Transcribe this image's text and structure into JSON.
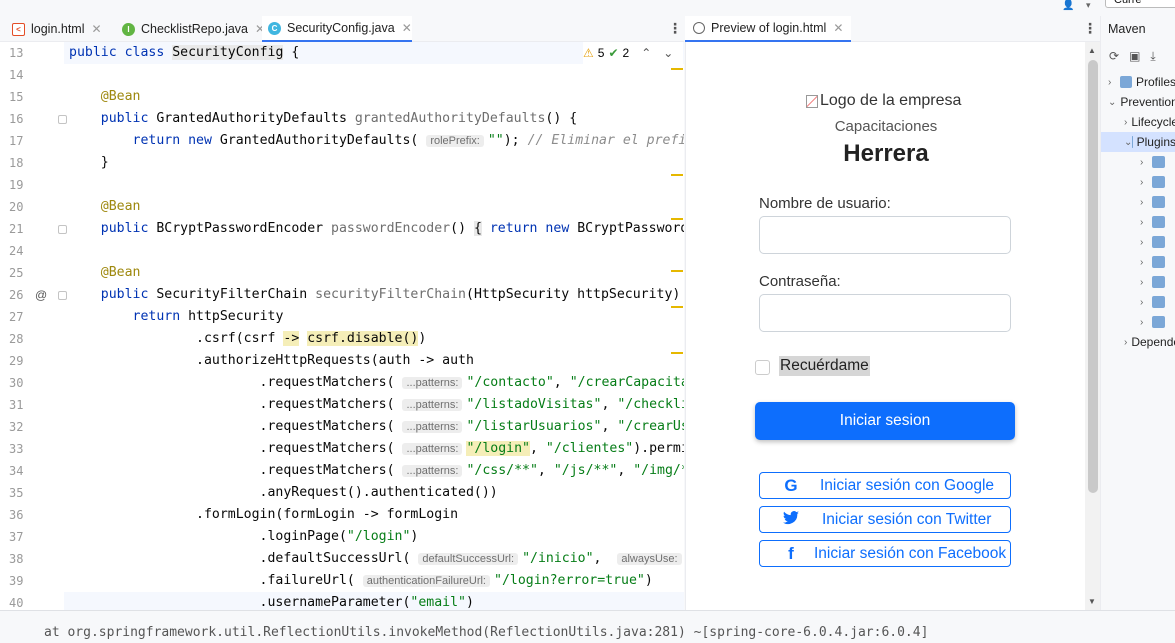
{
  "top": {
    "current_label": "Curre"
  },
  "editor_tabs": [
    {
      "label": "login.html",
      "icon": "html-file-icon",
      "color": "#e44d26"
    },
    {
      "label": "ChecklistRepo.java",
      "icon": "interface-icon",
      "color": "#62b543"
    },
    {
      "label": "SecurityConfig.java",
      "icon": "class-icon",
      "color": "#40b6e0"
    }
  ],
  "inspections": {
    "warnings": "5",
    "weak_warnings": "2"
  },
  "code_lines": [
    {
      "n": "13",
      "html": "<span class=\"kw\">public class</span> <span class=\"hlb\">SecurityConfig</span> {"
    },
    {
      "n": "14",
      "html": ""
    },
    {
      "n": "15",
      "html": "    <span class=\"ann\">@Bean</span>"
    },
    {
      "n": "16",
      "html": "    <span class=\"kw\">public</span> GrantedAuthorityDefaults <span class=\"unused\">grantedAuthorityDefaults</span>() {"
    },
    {
      "n": "17",
      "html": "        <span class=\"kw\">return new</span> GrantedAuthorityDefaults( <span class=\"hint\">rolePrefix:</span><span class=\"str\">\"\"</span>); <span class=\"cm\">// Eliminar el prefijo ROLE_</span>"
    },
    {
      "n": "18",
      "html": "    }"
    },
    {
      "n": "19",
      "html": ""
    },
    {
      "n": "20",
      "html": "    <span class=\"ann\">@Bean</span>"
    },
    {
      "n": "21",
      "html": "    <span class=\"kw\">public</span> BCryptPasswordEncoder <span class=\"unused\">passwordEncoder</span>() <span class=\"hlb\">{</span> <span class=\"kw\">return new</span> BCryptPasswordEncoder(); }"
    },
    {
      "n": "24",
      "html": ""
    },
    {
      "n": "25",
      "html": "    <span class=\"ann\">@Bean</span>"
    },
    {
      "n": "26",
      "html": "    <span class=\"kw\">public</span> SecurityFilterChain <span class=\"unused\">securityFilterChain</span>(HttpSecurity httpSecurity) <span class=\"kw\">throws</span>"
    },
    {
      "n": "27",
      "html": "        <span class=\"kw\">return</span> httpSecurity"
    },
    {
      "n": "28",
      "html": "                .csrf(csrf <span class=\"hl\">-&gt;</span> <span class=\"hl\">csrf.disable()</span>)"
    },
    {
      "n": "29",
      "html": "                .authorizeHttpRequests(auth -&gt; auth"
    },
    {
      "n": "30",
      "html": "                        .requestMatchers( <span class=\"hint\">...patterns:</span><span class=\"str\">\"/contacto\"</span>, <span class=\"str\">\"/crearCapacitacion\"</span>"
    },
    {
      "n": "31",
      "html": "                        .requestMatchers( <span class=\"hint\">...patterns:</span><span class=\"str\">\"/listadoVisitas\"</span>, <span class=\"str\">\"/checklist\"</span>"
    },
    {
      "n": "32",
      "html": "                        .requestMatchers( <span class=\"hint\">...patterns:</span><span class=\"str\">\"/listarUsuarios\"</span>, <span class=\"str\">\"/crearUsuario\"</span>"
    },
    {
      "n": "33",
      "html": "                        .requestMatchers( <span class=\"hint\">...patterns:</span><span class=\"str hl\">\"/login\"</span>, <span class=\"str\">\"/clientes\"</span>).permitAll()"
    },
    {
      "n": "34",
      "html": "                        .requestMatchers( <span class=\"hint\">...patterns:</span><span class=\"str\">\"/css/**\"</span>, <span class=\"str\">\"/js/**\"</span>, <span class=\"str\">\"/img/**\"</span>"
    },
    {
      "n": "35",
      "html": "                        .anyRequest().authenticated())"
    },
    {
      "n": "36",
      "html": "                .formLogin(formLogin -&gt; formLogin"
    },
    {
      "n": "37",
      "html": "                        .loginPage(<span class=\"str\">\"/login\"</span>)"
    },
    {
      "n": "38",
      "html": "                        .defaultSuccessUrl( <span class=\"hint\">defaultSuccessUrl:</span><span class=\"str\">\"/inicio\"</span>,  <span class=\"hint\">alwaysUse:</span><span class=\"kw\">true</span>)"
    },
    {
      "n": "39",
      "html": "                        .failureUrl( <span class=\"hint\">authenticationFailureUrl:</span><span class=\"str\">\"/login?error=true\"</span>)"
    },
    {
      "n": "40",
      "html": "                        .usernameParameter(<span class=\"str\">\"email\"</span>)"
    }
  ],
  "preview": {
    "tab_label": "Preview of login.html",
    "logo_alt": "Logo de la empresa",
    "brand_line1": "Capacitaciones",
    "brand_line2": "Herrera",
    "username_label": "Nombre de usuario:",
    "password_label": "Contraseña:",
    "remember_label": "Recuérdame",
    "submit_label": "Iniciar sesion",
    "google_label": "Iniciar sesión con Google",
    "twitter_label": "Iniciar sesión con Twitter",
    "facebook_label": "Iniciar sesión con Facebook",
    "primary_color": "#0d6efd"
  },
  "maven": {
    "title": "Maven",
    "items": [
      {
        "label": "Profiles",
        "indent": 0,
        "caret": "›",
        "selected": false
      },
      {
        "label": "Prevention",
        "indent": 0,
        "caret": "⌄",
        "selected": false
      },
      {
        "label": "Lifecycle",
        "indent": 1,
        "caret": "›",
        "selected": false
      },
      {
        "label": "Plugins",
        "indent": 1,
        "caret": "⌄",
        "selected": true
      },
      {
        "label": "",
        "indent": 2,
        "caret": "›",
        "selected": false
      },
      {
        "label": "",
        "indent": 2,
        "caret": "›",
        "selected": false
      },
      {
        "label": "",
        "indent": 2,
        "caret": "›",
        "selected": false
      },
      {
        "label": "",
        "indent": 2,
        "caret": "›",
        "selected": false
      },
      {
        "label": "",
        "indent": 2,
        "caret": "›",
        "selected": false
      },
      {
        "label": "",
        "indent": 2,
        "caret": "›",
        "selected": false
      },
      {
        "label": "",
        "indent": 2,
        "caret": "›",
        "selected": false
      },
      {
        "label": "",
        "indent": 2,
        "caret": "›",
        "selected": false
      },
      {
        "label": "",
        "indent": 2,
        "caret": "›",
        "selected": false
      },
      {
        "label": "Dependencies",
        "indent": 1,
        "caret": "›",
        "selected": false
      }
    ]
  },
  "bottom_text": "at org.springframework.util.ReflectionUtils.invokeMethod(ReflectionUtils.java:281) ~[spring-core-6.0.4.jar:6.0.4]"
}
